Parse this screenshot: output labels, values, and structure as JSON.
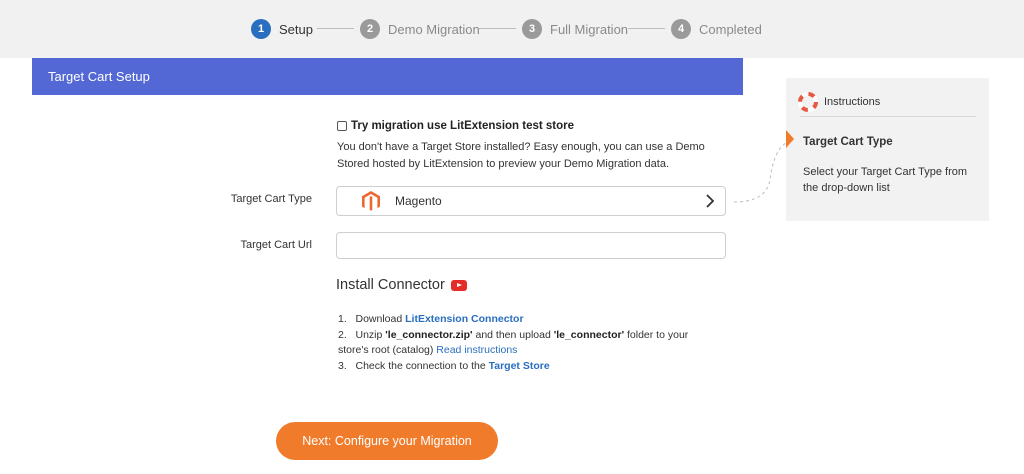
{
  "stepper": {
    "steps": [
      {
        "num": "1",
        "label": "Setup"
      },
      {
        "num": "2",
        "label": "Demo Migration"
      },
      {
        "num": "3",
        "label": "Full Migration"
      },
      {
        "num": "4",
        "label": "Completed"
      }
    ],
    "active_step": 1
  },
  "panel": {
    "title": "Target Cart Setup"
  },
  "demo_option": {
    "label": "Try migration use LitExtension test store",
    "checked": false,
    "description": "You don't have a Target Store installed? Easy enough, you can use a Demo Stored hosted by LitExtension to preview your Demo Migration data."
  },
  "form": {
    "cart_type_label": "Target Cart Type",
    "cart_type_value": "Magento",
    "cart_url_label": "Target Cart Url",
    "cart_url_value": "",
    "cart_url_placeholder": ""
  },
  "connector": {
    "title": "Install Connector",
    "step1_prefix": "1.   Download ",
    "step1_link": "LitExtension Connector",
    "step2_prefix": "2.   Unzip ",
    "step2_file": "'le_connector.zip'",
    "step2_mid": " and then upload ",
    "step2_folder": "'le_connector'",
    "step2_suffix": " folder to your store's root (catalog) ",
    "step2_link": "Read instructions",
    "step3_prefix": "3.   Check the connection to the ",
    "step3_link": "Target Store"
  },
  "actions": {
    "next_label": "Next: Configure your Migration"
  },
  "instructions": {
    "header": "Instructions",
    "title": "Target Cart Type",
    "text": "Select your Target Cart Type from the drop-down list"
  },
  "colors": {
    "header_blue": "#5368d4",
    "accent_orange": "#f07c2b",
    "active_step_blue": "#2a6ebf",
    "link_blue": "#2a6ebf",
    "magento_orange": "#ee672f"
  },
  "icons": {
    "instructions": "lifebuoy-icon",
    "cart_type": "magento-logo-icon",
    "select": "chevron-right-icon",
    "video": "youtube-icon"
  }
}
